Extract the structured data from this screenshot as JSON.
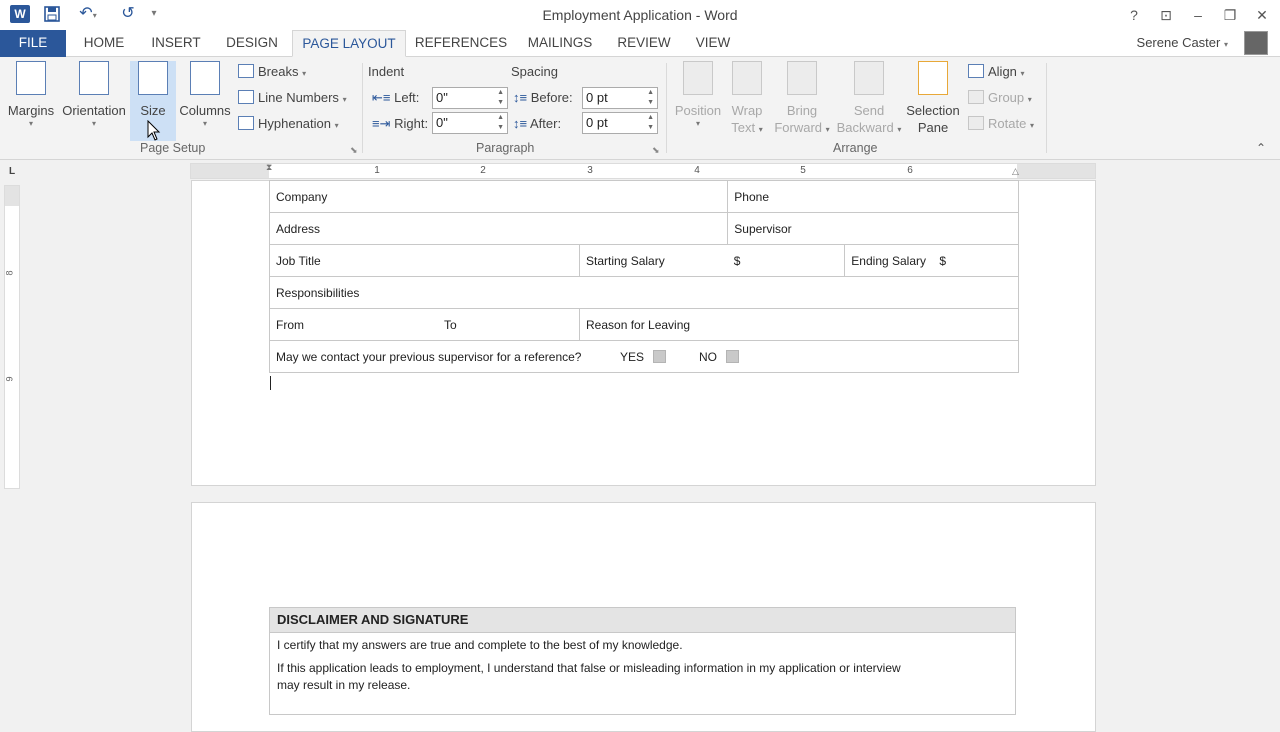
{
  "window": {
    "title": "Employment Application - Word",
    "help": "?",
    "buttons": [
      "?",
      "⊡",
      "–",
      "❐",
      "✕"
    ]
  },
  "qat": {
    "save_icon": "save-icon",
    "undo_icon": "undo-icon",
    "redo_icon": "redo-icon",
    "customize": "▾"
  },
  "tabs": [
    "FILE",
    "HOME",
    "INSERT",
    "DESIGN",
    "PAGE LAYOUT",
    "REFERENCES",
    "MAILINGS",
    "REVIEW",
    "VIEW"
  ],
  "active_tab": "PAGE LAYOUT",
  "user": {
    "name": "Serene Caster",
    "caret": "▾"
  },
  "ribbon": {
    "page_setup": {
      "label": "Page Setup",
      "margins": "Margins",
      "orientation": "Orientation",
      "size": "Size",
      "columns": "Columns",
      "breaks": "Breaks",
      "line_numbers": "Line Numbers",
      "hyphenation": "Hyphenation"
    },
    "paragraph": {
      "label": "Paragraph",
      "indent": "Indent",
      "spacing": "Spacing",
      "left_label": "Left:",
      "left_value": "0\"",
      "right_label": "Right:",
      "right_value": "0\"",
      "before_label": "Before:",
      "before_value": "0 pt",
      "after_label": "After:",
      "after_value": "0 pt"
    },
    "arrange": {
      "label": "Arrange",
      "position": "Position",
      "wrap_text_1": "Wrap",
      "wrap_text_2": "Text",
      "bring_forward_1": "Bring",
      "bring_forward_2": "Forward",
      "send_backward_1": "Send",
      "send_backward_2": "Backward",
      "selection_pane_1": "Selection",
      "selection_pane_2": "Pane",
      "align": "Align",
      "group": "Group",
      "rotate": "Rotate"
    }
  },
  "ruler": {
    "numbers": [
      "1",
      "2",
      "3",
      "4",
      "5",
      "6"
    ],
    "vnumbers": [
      "8",
      "9"
    ],
    "corner": "L"
  },
  "form": {
    "company": "Company",
    "phone": "Phone",
    "address": "Address",
    "supervisor": "Supervisor",
    "job_title": "Job Title",
    "starting_salary": "Starting Salary",
    "dollar1": "$",
    "ending_salary": "Ending Salary",
    "dollar2": "$",
    "responsibilities": "Responsibilities",
    "from": "From",
    "to": "To",
    "reason": "Reason for Leaving",
    "contact_question": "May we contact your previous supervisor for a reference?",
    "yes": "YES",
    "no": "NO"
  },
  "disclaimer": {
    "heading": "DISCLAIMER AND SIGNATURE",
    "line1": "I certify that my answers are true and complete to the best of my knowledge.",
    "line2a": "If this application leads to employment, I understand that false or misleading information in my application or interview",
    "line2b": "may result in my release."
  },
  "colors": {
    "brand": "#2b579a",
    "ribbon_bg": "#f3f3f3",
    "workspace": "#f1f1f1"
  }
}
